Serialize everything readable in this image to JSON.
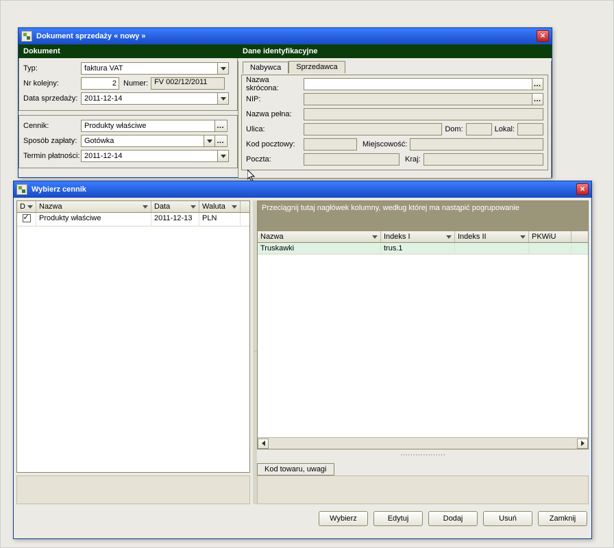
{
  "win1": {
    "title": "Dokument sprzedaży  « nowy »",
    "sections": {
      "doc": "Dokument",
      "id": "Dane identyfikacyjne"
    },
    "labels": {
      "typ": "Typ:",
      "nrkol": "Nr kolejny:",
      "numer": "Numer:",
      "datasp": "Data sprzedaży:",
      "cennik": "Cennik:",
      "sposob": "Sposób zapłaty:",
      "termin": "Termin płatności:"
    },
    "values": {
      "typ": "faktura VAT",
      "nrkol": "2",
      "numer": "FV 002/12/2011",
      "datasp": "2011-12-14",
      "cennik": "Produkty właściwe",
      "sposob": "Gotówka",
      "termin": "2011-12-14"
    },
    "ident": {
      "tab_nabywca": "Nabywca",
      "tab_sprzedawca": "Sprzedawca",
      "nazwa_skr": "Nazwa skrócona:",
      "nip": "NIP:",
      "nazwa_pelna": "Nazwa pełna:",
      "ulica": "Ulica:",
      "dom": "Dom:",
      "lokal": "Lokal:",
      "kod": "Kod pocztowy:",
      "miejscowosc": "Miejscowość:",
      "poczta": "Poczta:",
      "kraj": "Kraj:"
    }
  },
  "win2": {
    "title": "Wybierz cennik",
    "left_cols": {
      "d": "D",
      "nazwa": "Nazwa",
      "data": "Data",
      "waluta": "Waluta"
    },
    "left_row": {
      "nazwa": "Produkty właściwe",
      "data": "2011-12-13",
      "waluta": "PLN"
    },
    "group_hint": "Przeciągnij tutaj nagłówek kolumny, według której ma nastąpić pogrupowanie",
    "right_cols": {
      "nazwa": "Nazwa",
      "idx1": "Indeks I",
      "idx2": "Indeks II",
      "pkwiu": "PKWiU"
    },
    "right_row": {
      "nazwa": "Truskawki",
      "idx1": "trus.1",
      "idx2": "",
      "pkwiu": ""
    },
    "tab_kod": "Kod towaru, uwagi",
    "buttons": {
      "wybierz": "Wybierz",
      "edytuj": "Edytuj",
      "dodaj": "Dodaj",
      "usun": "Usuń",
      "zamknij": "Zamknij"
    }
  }
}
